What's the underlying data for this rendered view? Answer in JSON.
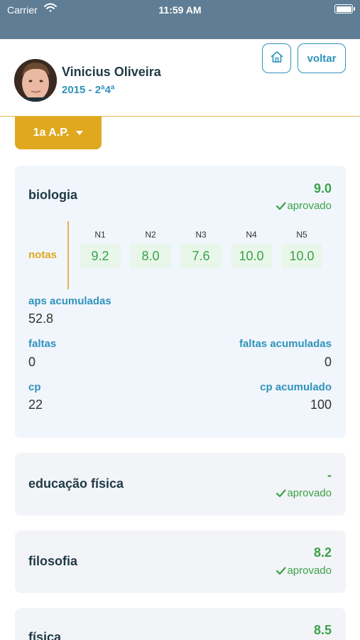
{
  "status_bar": {
    "carrier": "Carrier",
    "time": "11:59 AM"
  },
  "header": {
    "student_name": "Vinicius Oliveira",
    "student_class": "2015 - 2ª4ª",
    "back_label": "voltar"
  },
  "period": {
    "label": "1a A.P."
  },
  "subjects": [
    {
      "name": "biologia",
      "grade": "9.0",
      "status": "aprovado",
      "notas_label": "notas",
      "notes": [
        {
          "head": "N1",
          "value": "9.2"
        },
        {
          "head": "N2",
          "value": "8.0"
        },
        {
          "head": "N3",
          "value": "7.6"
        },
        {
          "head": "N4",
          "value": "10.0"
        },
        {
          "head": "N5",
          "value": "10.0"
        }
      ],
      "aps_label": "aps acumuladas",
      "aps_value": "52.8",
      "faltas_label": "faltas",
      "faltas_value": "0",
      "faltas_acum_label": "faltas acumuladas",
      "faltas_acum_value": "0",
      "cp_label": "cp",
      "cp_value": "22",
      "cp_acum_label": "cp acumulado",
      "cp_acum_value": "100"
    },
    {
      "name": "educação física",
      "grade": "-",
      "status": "aprovado"
    },
    {
      "name": "filosofia",
      "grade": "8.2",
      "status": "aprovado"
    },
    {
      "name": "física",
      "grade": "8.5"
    }
  ],
  "colors": {
    "status_bar": "#5f7d94",
    "accent_blue": "#2f93ba",
    "accent_gold": "#e0a81e",
    "success_green": "#3aa24a",
    "title_dark": "#1f3a45"
  },
  "icons": {
    "wifi": "wifi-icon",
    "battery": "battery-icon",
    "home": "home-icon",
    "dropdown": "caret-down-icon",
    "check": "check-icon"
  }
}
